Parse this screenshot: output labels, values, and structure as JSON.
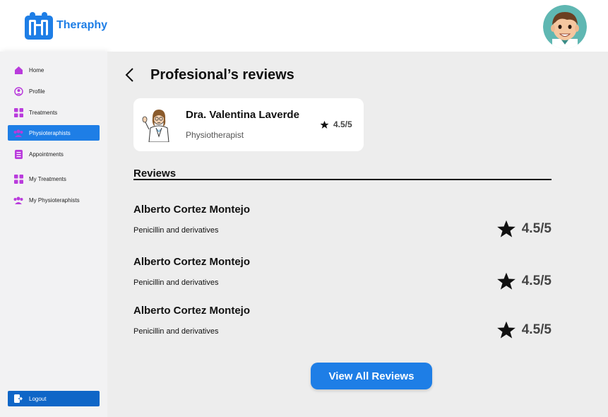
{
  "app": {
    "name": "Theraphy",
    "brand_color": "#1e7ee6"
  },
  "user": {
    "avatar_icon": "user-avatar"
  },
  "sidebar": {
    "items": [
      {
        "label": "Home",
        "icon": "home-icon",
        "active": false
      },
      {
        "label": "Profile",
        "icon": "profile-icon",
        "active": false
      },
      {
        "label": "Treatments",
        "icon": "grid-icon",
        "active": false
      },
      {
        "label": "Physioteraphists",
        "icon": "group-icon",
        "active": true
      },
      {
        "label": "Appointments",
        "icon": "list-icon",
        "active": false
      },
      {
        "label": "My Treatments",
        "icon": "grid-icon",
        "active": false
      },
      {
        "label": "My Physioteraphists",
        "icon": "group-icon",
        "active": false
      }
    ],
    "logout_label": "Logout"
  },
  "main": {
    "title": "Profesional’s reviews",
    "professional": {
      "name": "Dra. Valentina Laverde",
      "role": "Physiotherapist",
      "rating": "4.5/5"
    },
    "reviews_heading": "Reviews",
    "reviews": [
      {
        "name": "Alberto Cortez Montejo",
        "text": "Penicillin and derivatives",
        "rating": "4.5/5"
      },
      {
        "name": "Alberto Cortez Montejo",
        "text": "Penicillin and derivatives",
        "rating": "4.5/5"
      },
      {
        "name": "Alberto Cortez Montejo",
        "text": "Penicillin and derivatives",
        "rating": "4.5/5"
      }
    ],
    "view_all_label": "View All Reviews"
  }
}
